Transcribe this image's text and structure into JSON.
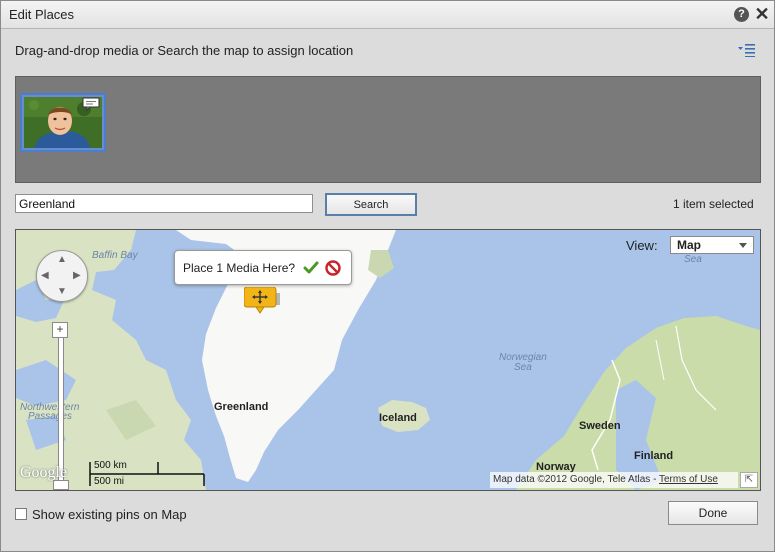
{
  "window": {
    "title": "Edit Places",
    "help_icon": "question-mark-icon",
    "close_icon": "close-icon",
    "help_glyph": "?",
    "close_glyph": "✕"
  },
  "instructions": "Drag-and-drop media or Search the map to assign location",
  "options_icon": "list-options-icon",
  "media": {
    "items": [
      {
        "name": "photo-thumbnail",
        "has_comment_badge": true
      }
    ]
  },
  "search": {
    "value": "Greenland",
    "button_label": "Search"
  },
  "selection_status": "1 item selected",
  "map": {
    "view_label": "View:",
    "view_value": "Map",
    "callout_text": "Place 1 Media Here?",
    "confirm_icon": "check-icon",
    "cancel_icon": "cancel-icon",
    "pin_icon": "move-pin-icon",
    "labels": {
      "baffin_bay": "Baffin Bay",
      "sea_top": "Sea",
      "norwegian_sea_1": "Norwegian",
      "norwegian_sea_2": "Sea",
      "northwestern_1": "Northwestern",
      "northwestern_2": "Passages",
      "greenland": "Greenland",
      "iceland": "Iceland",
      "sweden": "Sweden",
      "finland": "Finland",
      "norway": "Norway"
    },
    "zoom_plus": "+",
    "scale_km": "500 km",
    "scale_mi": "500 mi",
    "google_logo": "Google",
    "attribution_prefix": "Map data ©2012 Google, Tele Atlas - ",
    "terms_link": "Terms of Use",
    "corner_glyph": "⇱"
  },
  "footer": {
    "show_pins_label": "Show existing pins on Map",
    "show_pins_checked": false,
    "done_label": "Done"
  }
}
